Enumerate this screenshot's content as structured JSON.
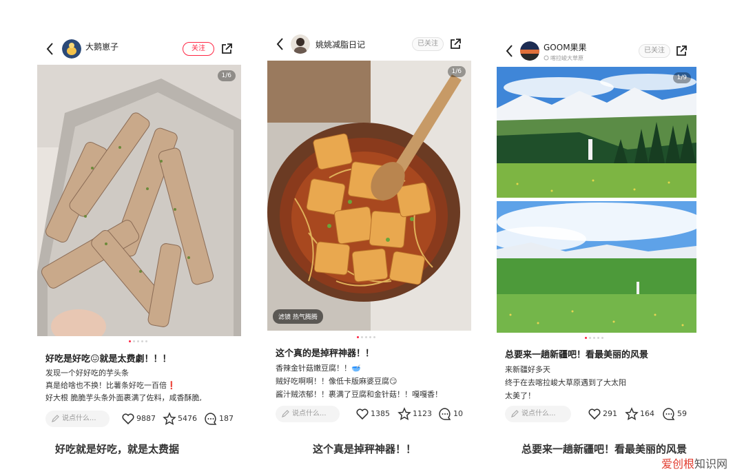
{
  "notes": [
    {
      "author": "大鹅崽子",
      "follow_label": "关注",
      "counter": "1/6",
      "title": "好吃是好吃😖就是太费劇！！！",
      "body": [
        "发现一个好好吃的芋头条",
        "真是给啥也不换！比薯条好吃一百倍❗",
        "好大根 脆脆芋头条外面裹满了佐料，咸香酥脆,"
      ],
      "comment_placeholder": "说点什么...",
      "likes": "9887",
      "stars": "5476",
      "comments": "187",
      "caption": "好吃就是好吃，就是太费据",
      "colors": {
        "follow": "#ff2442"
      },
      "icons": [
        "back-icon",
        "share-icon",
        "pencil-icon",
        "heart-icon",
        "star-icon",
        "comment-icon"
      ]
    },
    {
      "author": "姚姚减脂日记",
      "follow_label": "已关注",
      "counter": "1/6",
      "filter_tag": "滤镜  热气腾腾",
      "title": "这个真的是掉秤神器！！",
      "body": [
        "香辣金针菇嫩豆腐！！🥣",
        "贼好吃啊啊！！像低卡版麻婆豆腐😏",
        "酱汁贼浓郁！！裹满了豆腐和金针菇！！嘎嘎香！"
      ],
      "comment_placeholder": "说点什么...",
      "likes": "1385",
      "stars": "1123",
      "comments": "10",
      "caption": "这个真是掉秤神器！！"
    },
    {
      "author": "GOOM果果",
      "location": "喀拉峻大草原",
      "follow_label": "已关注",
      "counter": "1/9",
      "title": "总要来一趟新疆吧！看最美丽的风景",
      "body": [
        "来新疆好多天",
        "终于在去喀拉峻大草原遇到了大太阳",
        "太美了！"
      ],
      "comment_placeholder": "说点什么...",
      "likes": "291",
      "stars": "164",
      "comments": "59",
      "caption": "总要来一趟新疆吧！看最美丽的风景"
    }
  ],
  "watermark": {
    "brand": "爱创根",
    "suffix": "知识网"
  }
}
